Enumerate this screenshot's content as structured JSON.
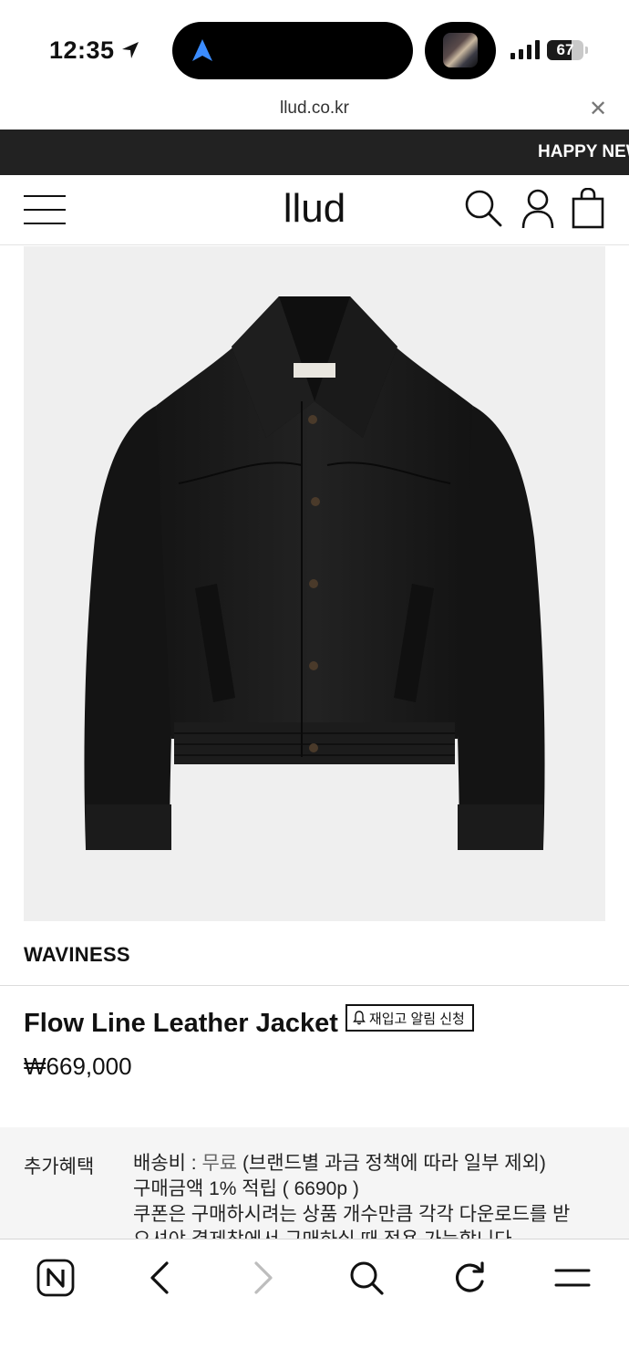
{
  "status_bar": {
    "time": "12:35",
    "battery": "67",
    "battery_level": 0.67
  },
  "browser": {
    "url": "llud.co.kr"
  },
  "banner": {
    "text": "HAPPY NEW YEAR"
  },
  "site": {
    "logo": "llud"
  },
  "product": {
    "brand": "WAVINESS",
    "title": "Flow Line Leather Jacket",
    "restock_label": "재입고 알림 신청",
    "price": "₩669,000"
  },
  "benefits": {
    "label": "추가혜택",
    "shipping_prefix": "배송비 : ",
    "shipping_free": "무료",
    "shipping_suffix": " (브랜드별 과금 정책에 따라 일부 제외)",
    "points": "구매금액 1% 적립 ( 6690p )",
    "coupon_line1": "쿠폰은 구매하시려는 상품 개수만큼 각각 다운로드를 받",
    "coupon_line2": "으셔야 결제창에서 구매하실 때 적용 가능합니다"
  },
  "icons": {
    "menu": "hamburger-icon",
    "search": "search-icon",
    "account": "user-icon",
    "bag": "shopping-bag-icon",
    "naver": "naver-home-icon",
    "back": "chevron-left-icon",
    "forward": "chevron-right-icon",
    "toolbar_search": "search-icon",
    "reload": "reload-icon",
    "toolbar_menu": "menu-icon"
  }
}
